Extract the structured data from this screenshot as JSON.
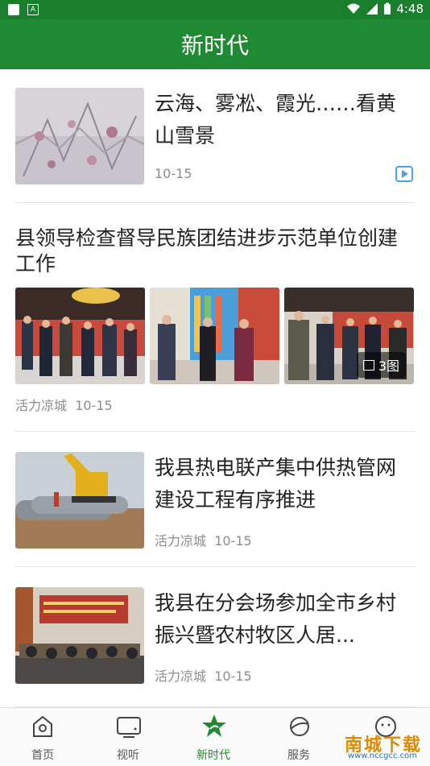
{
  "status_bar": {
    "time": "4:48",
    "notification_letter": "A"
  },
  "app": {
    "title": "新时代"
  },
  "feed": {
    "articles": [
      {
        "title": "云海、雾凇、霞光……看黄山雪景",
        "date": "10-15",
        "has_video": true
      },
      {
        "title": "县领导检查督导民族团结进步示范单位创建工作",
        "source": "活力凉城",
        "date": "10-15",
        "image_count": "3图"
      },
      {
        "title": "我县热电联产集中供热管网建设工程有序推进",
        "source": "活力凉城",
        "date": "10-15"
      },
      {
        "title": "我县在分会场参加全市乡村振兴暨农村牧区人居...",
        "source": "活力凉城",
        "date": "10-15"
      }
    ]
  },
  "tabbar": {
    "tabs": [
      {
        "label": "首页"
      },
      {
        "label": "视听"
      },
      {
        "label": "新时代",
        "active": true
      },
      {
        "label": "服务"
      },
      {
        "label": ""
      }
    ]
  },
  "watermark": {
    "text": "南城下载",
    "url": "www.nccgcc.com"
  },
  "colors": {
    "primary_green": "#1f8a33",
    "status_green": "#1a7f2c",
    "video_blue": "#4aa3df"
  }
}
